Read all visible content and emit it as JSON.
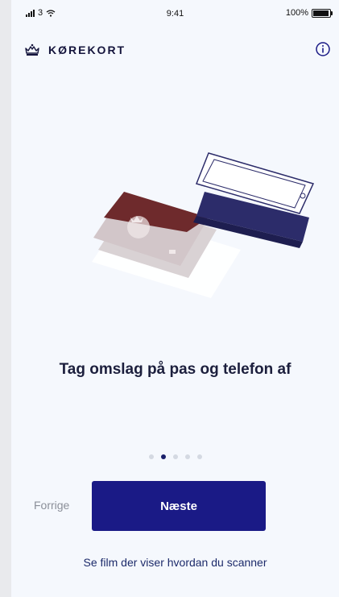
{
  "status_bar": {
    "carrier": "3",
    "time": "9:41",
    "battery_percent_label": "100%",
    "icons": [
      "signal-icon",
      "wifi-icon",
      "battery-icon"
    ]
  },
  "header": {
    "logo_icon": "crown-icon",
    "title": "KØREKORT",
    "info_icon": "info-icon"
  },
  "onboarding": {
    "illustration": "passport-and-phone-illustration",
    "title": "Tag omslag på pas og telefon af",
    "page_indicator": {
      "total": 5,
      "current": 2
    }
  },
  "actions": {
    "previous_label": "Forrige",
    "next_label": "Næste",
    "video_link": "Se film der viser hvordan du scanner"
  },
  "colors": {
    "background": "#f5f8fd",
    "primary": "#1a1a86",
    "brand_text": "#14143c",
    "passport_cover": "#6e2a2c",
    "phone_case": "#2c2c6a"
  }
}
